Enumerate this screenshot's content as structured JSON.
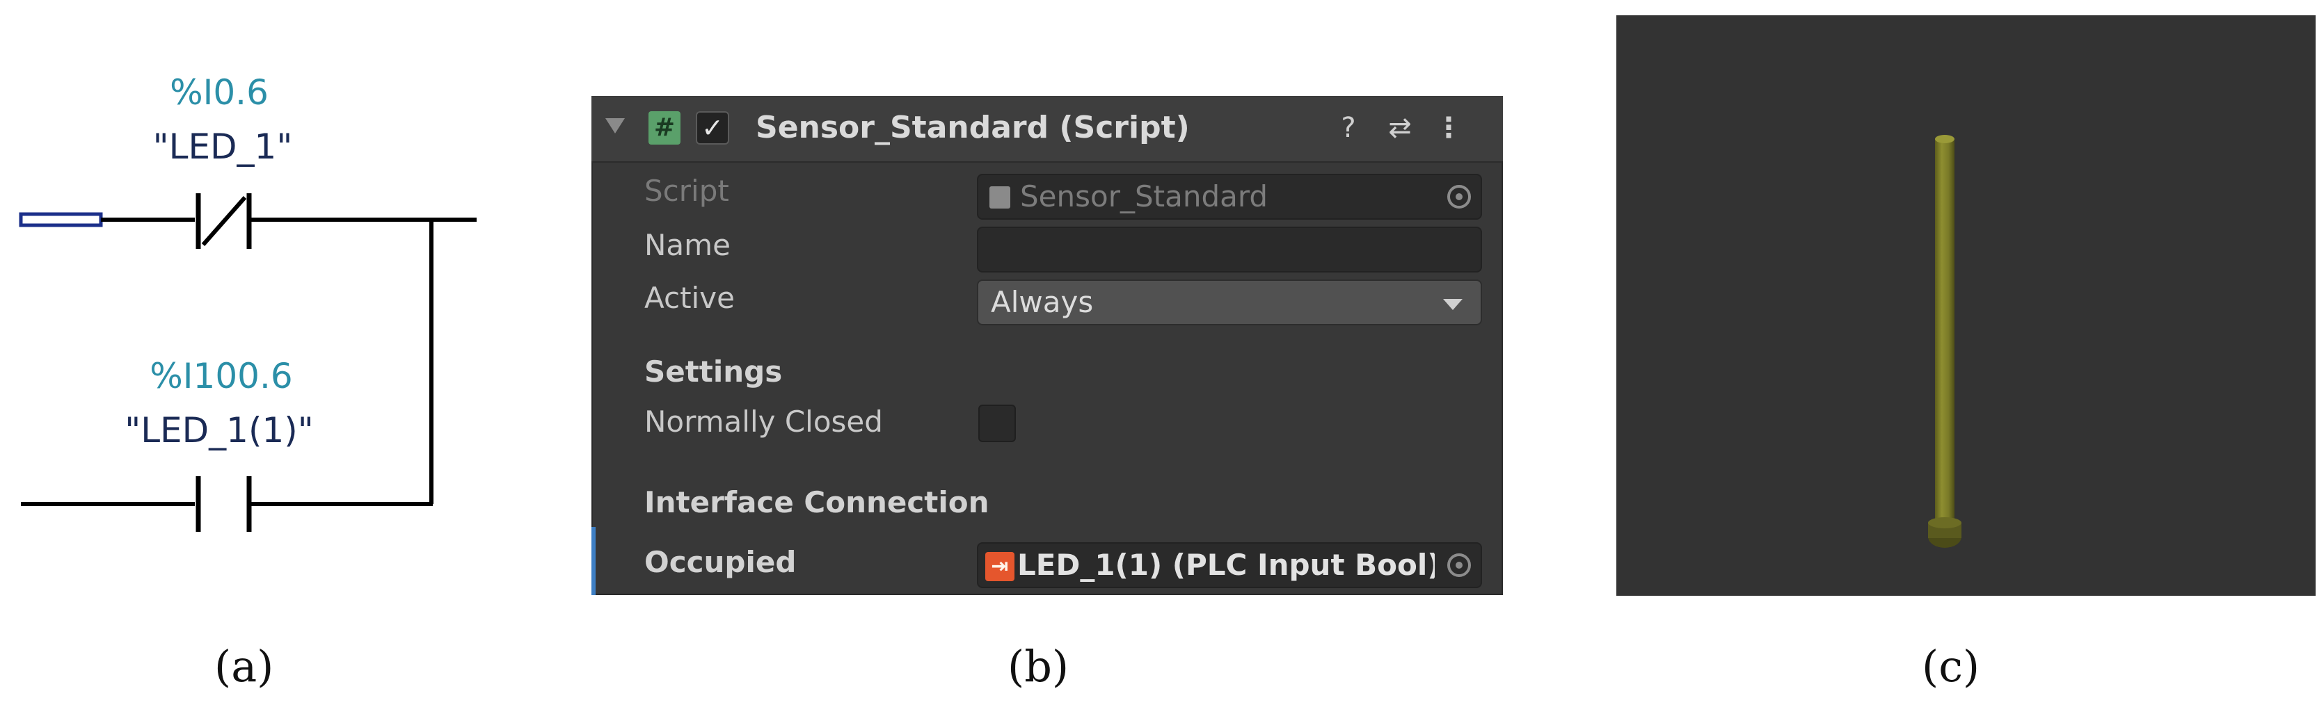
{
  "panel_a": {
    "contact_nc": {
      "address": "%I0.6",
      "tag": "\"LED_1\""
    },
    "contact_no": {
      "address": "%I100.6",
      "tag": "\"LED_1(1)\""
    }
  },
  "panel_b": {
    "component_title": "Sensor_Standard (Script)",
    "enabled_checkmark": "✓",
    "script_icon_glyph": "#",
    "header_icons": [
      "help-icon",
      "presets-icon",
      "kebab-menu-icon"
    ],
    "help_glyph": "?",
    "presets_glyph": "⇄",
    "menu_glyph": "⋮",
    "rows": {
      "script_label": "Script",
      "script_value": "Sensor_Standard",
      "name_label": "Name",
      "name_value": "",
      "active_label": "Active",
      "active_value": "Always",
      "settings_header": "Settings",
      "normally_closed_label": "Normally Closed",
      "normally_closed_checked": false,
      "interface_header": "Interface Connection",
      "occupied_label": "Occupied",
      "occupied_value": "LED_1(1) (PLC Input Bool)",
      "plc_icon_glyph": "⇥"
    },
    "colors": {
      "background": "#383838",
      "header": "#3e3e3e",
      "plc_icon": "#e5562d",
      "accent": "#3e7fc4"
    }
  },
  "panel_c": {
    "object_color": "#8a8a2e",
    "background": "#333333"
  },
  "captions": {
    "a": "(a)",
    "b": "(b)",
    "c": "(c)"
  }
}
